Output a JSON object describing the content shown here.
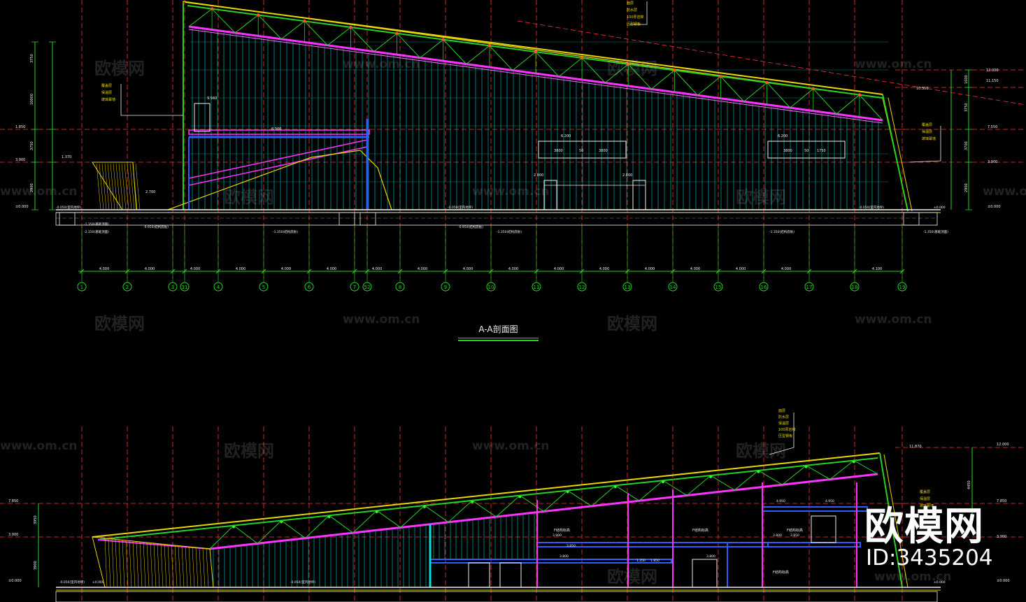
{
  "title": "A-A剖面图",
  "watermark": {
    "brand": "欧模网",
    "url": "www.om.cn",
    "id": "ID:3435204"
  },
  "grid_axes": [
    "1",
    "2",
    "3",
    "31",
    "4",
    "5",
    "6",
    "7",
    "52",
    "8",
    "9",
    "10",
    "11",
    "12",
    "13",
    "14",
    "15",
    "16",
    "17",
    "18",
    "19"
  ],
  "spans": [
    "4.000",
    "4.000",
    "4.000",
    "4.000",
    "4.000",
    "4.000",
    "4.000",
    "4.000",
    "4.000",
    "4.000",
    "4.000",
    "4.000",
    "4.000",
    "4.000",
    "4.000",
    "4.000",
    "4.100"
  ],
  "top_section": {
    "elevations_left": [
      "1.850",
      "3.900",
      "±0.000"
    ],
    "elevations_right": [
      "12.000",
      "11.150",
      "10.350",
      "7.550",
      "3.900",
      "±0.000"
    ],
    "roof_legend": [
      "面层",
      "防水层",
      "100厚岩棉",
      "压型钢板"
    ],
    "wall_legend_left": [
      "覆盖层",
      "保温层",
      "玻璃幕墙"
    ],
    "wall_legend_right": [
      "覆盖层",
      "保温层",
      "玻璃幕墙"
    ],
    "dims_left": [
      "3750",
      "10000",
      "3750",
      "2900"
    ],
    "dims_right": [
      "1600",
      "3750",
      "3700",
      "2900"
    ],
    "floor_labels": [
      "-0.050(室内地坪)",
      "-0.050(室内地坪)",
      "-0.050(室内地坪)",
      "±0.000"
    ],
    "below_labels": [
      "-1.350(基础顶面)",
      "-2.150(基础顶面)",
      "-0.950(结构底板)",
      "-1.350(结构底板)",
      "-0.950(结构底板)",
      "-1.350(结构底板)",
      "-1.350(结构底板)",
      "-1.350(基础顶面)"
    ],
    "misc_labels": [
      "9.560",
      "6.900",
      "6.200",
      "6.200",
      "2.800",
      "2.800",
      "2.700",
      "1.370",
      "3800",
      "50",
      "3800",
      "3800",
      "50",
      "1750"
    ]
  },
  "bottom_section": {
    "elevations_left": [
      "7.850",
      "3.900",
      "±0.000"
    ],
    "elevations_right": [
      "12.000",
      "11.870",
      "7.850",
      "3.900",
      "±0.000"
    ],
    "roof_legend": [
      "面层",
      "防水层",
      "保温层",
      "100厚岩棉",
      "压型钢板"
    ],
    "wall_legend_right": [
      "覆盖层",
      "保温层",
      "玻璃幕墙"
    ],
    "dims_left": [
      "3950",
      "3900"
    ],
    "dims_right": [
      "4450"
    ],
    "room_labels": [
      "F结构标高",
      "F结构标高",
      "F结构标高",
      "F结构标高"
    ],
    "misc_labels": [
      "4.950",
      "4.950",
      "3.900",
      "3.850",
      "3.800",
      "3.850",
      "1.350",
      "1.850",
      "3.800",
      "3.800",
      "-0.050(室内地坪)",
      "-0.050(室内地坪)",
      "±0.000",
      "±0.000"
    ]
  },
  "colors": {
    "background": "#000000",
    "grid_line": "#ff3333",
    "truss": "#23d323",
    "roof_slab": "#ff33ff",
    "mullion": "#00cccc",
    "structure_blue": "#2f5bff",
    "finish_yellow": "#e8d600",
    "text": "#f0f0f0"
  }
}
